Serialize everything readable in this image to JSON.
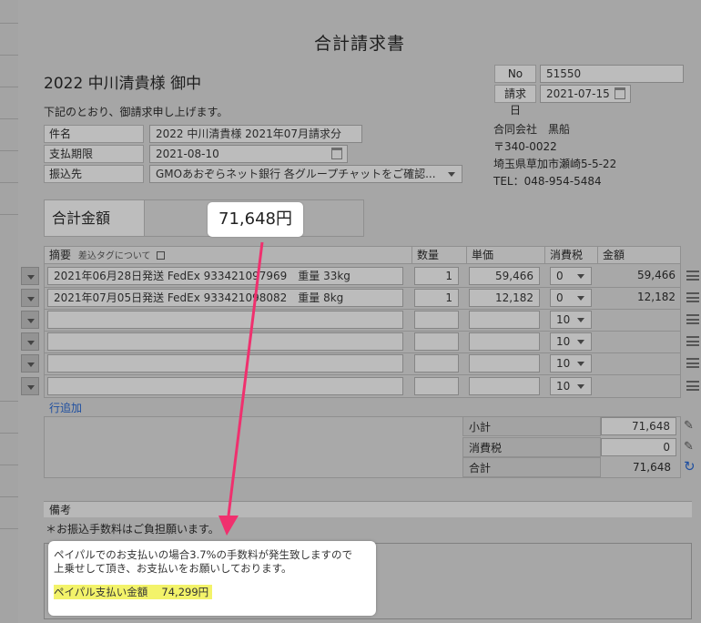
{
  "document": {
    "title": "合計請求書",
    "addressee": "2022 中川清貴様 御中",
    "intro": "下記のとおり、御請求申し上げます。"
  },
  "meta": {
    "no_label": "No",
    "no_value": "51550",
    "date_label": "請求日",
    "date_value": "2021-07-15"
  },
  "fields": {
    "subject_label": "件名",
    "subject_value": "2022 中川清貴様 2021年07月請求分",
    "due_label": "支払期限",
    "due_value": "2021-08-10",
    "bank_label": "振込先",
    "bank_value": "GMOあおぞらネット銀行 各グループチャットをご確認..."
  },
  "issuer": {
    "company": "合同会社　黒船",
    "postal": "〒340-0022",
    "address": "埼玉県草加市瀬崎5-5-22",
    "tel": "TEL：048-954-5484"
  },
  "total": {
    "label": "合計金額",
    "callout": "71,648円"
  },
  "table": {
    "headers": {
      "description": "摘要",
      "tag_link": "差込タグについて",
      "qty": "数量",
      "unit_price": "単価",
      "tax": "消費税",
      "amount": "金額"
    },
    "rows": [
      {
        "desc": "2021年06月28日発送 FedEx 933421097969　重量 33kg",
        "qty": "1",
        "price": "59,466",
        "tax": "0",
        "amount": "59,466"
      },
      {
        "desc": "2021年07月05日発送 FedEx 933421098082　重量 8kg",
        "qty": "1",
        "price": "12,182",
        "tax": "0",
        "amount": "12,182"
      },
      {
        "desc": "",
        "qty": "",
        "price": "",
        "tax": "10",
        "amount": ""
      },
      {
        "desc": "",
        "qty": "",
        "price": "",
        "tax": "10",
        "amount": ""
      },
      {
        "desc": "",
        "qty": "",
        "price": "",
        "tax": "10",
        "amount": ""
      },
      {
        "desc": "",
        "qty": "",
        "price": "",
        "tax": "10",
        "amount": ""
      }
    ],
    "add_row": "行追加"
  },
  "summary": {
    "subtotal_label": "小計",
    "subtotal_value": "71,648",
    "tax_label": "消費税",
    "tax_value": "0",
    "total_label": "合計",
    "total_value": "71,648"
  },
  "remarks": {
    "header": "備考",
    "note": "＊お振込手数料はご負担願います。",
    "popup_line1": "ペイパルでのお支払いの場合3.7%の手数料が発生致しますので",
    "popup_line2": "上乗せして頂き、お支払いをお願いしております。",
    "popup_highlight": "ペイパル支払い金額　 74,299円"
  },
  "colors": {
    "arrow": "#f0306e",
    "highlight": "#f3f36a",
    "link": "#1f4fa0"
  }
}
